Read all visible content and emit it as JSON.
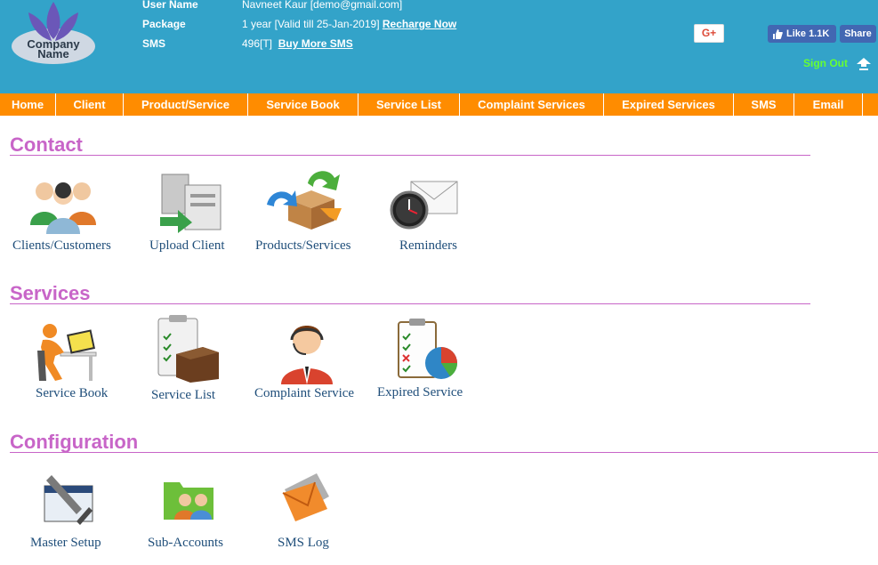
{
  "brand": {
    "logo_text_line1": "Company",
    "logo_text_line2": "Name"
  },
  "account": {
    "user_label": "User Name",
    "user_value": "Navneet Kaur [demo@gmail.com]",
    "package_label": "Package",
    "package_value": "1 year [Valid till 25-Jan-2019]",
    "recharge_link": "Recharge Now",
    "sms_label": "SMS",
    "sms_value": "496[T]",
    "buy_sms_link": "Buy More SMS"
  },
  "social": {
    "gplus_label": "G+",
    "fb_like_label": "Like 1.1K",
    "fb_share_label": "Share"
  },
  "signout_label": "Sign Out",
  "nav": [
    "Home",
    "Client",
    "Product/Service",
    "Service Book",
    "Service List",
    "Complaint Services",
    "Expired Services",
    "SMS",
    "Email"
  ],
  "sections": {
    "contact": {
      "title": "Contact",
      "items": [
        {
          "label": "Clients/Customers",
          "icon": "users-group-icon"
        },
        {
          "label": "Upload Client",
          "icon": "upload-servers-icon"
        },
        {
          "label": "Products/Services",
          "icon": "box-arrows-icon"
        },
        {
          "label": "Reminders",
          "icon": "clock-envelope-icon"
        }
      ]
    },
    "services": {
      "title": "Services",
      "items": [
        {
          "label": "Service Book",
          "icon": "person-desk-icon"
        },
        {
          "label": "Service List",
          "icon": "clipboard-box-icon"
        },
        {
          "label": "Complaint Service",
          "icon": "support-agent-icon"
        },
        {
          "label": "Expired Service",
          "icon": "checklist-chart-icon"
        }
      ]
    },
    "configuration": {
      "title": "Configuration",
      "items": [
        {
          "label": "Master Setup",
          "icon": "tools-window-icon"
        },
        {
          "label": "Sub-Accounts",
          "icon": "folder-users-icon"
        },
        {
          "label": "SMS Log",
          "icon": "envelope-icon"
        }
      ]
    }
  }
}
